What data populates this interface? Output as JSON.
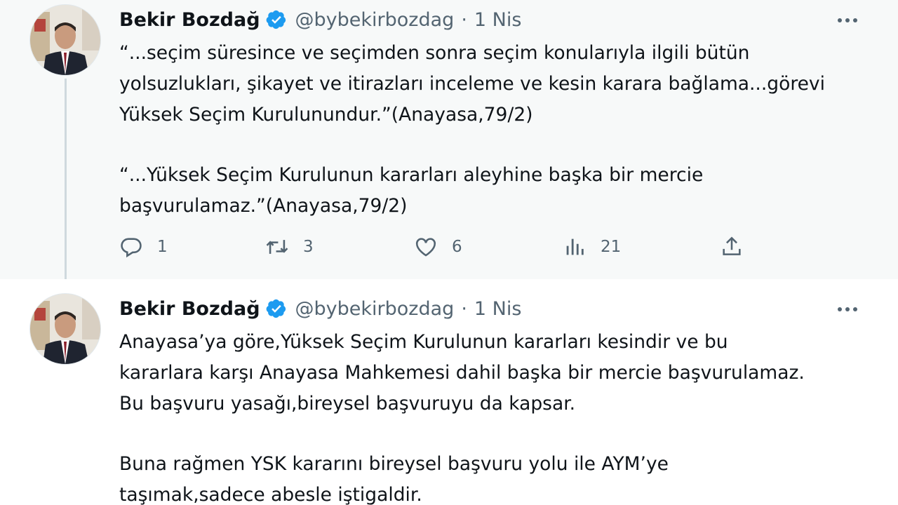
{
  "tweets": [
    {
      "author": {
        "name": "Bekir Bozdağ",
        "handle": "@bybekirbozdag",
        "verified": true
      },
      "date": "1 Nis",
      "lines": [
        "“...seçim süresince ve seçimden sonra seçim konularıyla ilgili bütün",
        "yolsuzlukları, şikayet ve itirazları inceleme ve kesin karara bağlama...görevi",
        "Yüksek Seçim Kurulunundur.”(Anayasa,79/2)",
        "",
        "“...Yüksek Seçim Kurulunun kararları aleyhine başka bir mercie",
        "başvurulamaz.”(Anayasa,79/2)"
      ],
      "metrics": {
        "replies": "1",
        "retweets": "3",
        "likes": "6",
        "views": "21"
      }
    },
    {
      "author": {
        "name": "Bekir Bozdağ",
        "handle": "@bybekirbozdag",
        "verified": true
      },
      "date": "1 Nis",
      "lines": [
        "Anayasa’ya göre,Yüksek Seçim Kurulunun kararları kesindir ve bu",
        "kararlara karşı Anayasa Mahkemesi dahil başka bir mercie başvurulamaz.",
        "Bu başvuru yasağı,bireysel başvuruyu da kapsar.",
        "",
        "Buna rağmen YSK kararını bireysel başvuru yolu ile AYM’ye",
        "taşımak,sadece abesle iştigaldir."
      ]
    }
  ],
  "colors": {
    "text": "#0f1419",
    "secondary": "#536471",
    "verified": "#1d9bf0",
    "thread_line": "#cfd9de"
  },
  "icons": [
    "verified-badge-icon",
    "more-icon",
    "reply-icon",
    "retweet-icon",
    "like-icon",
    "views-icon",
    "share-icon"
  ]
}
